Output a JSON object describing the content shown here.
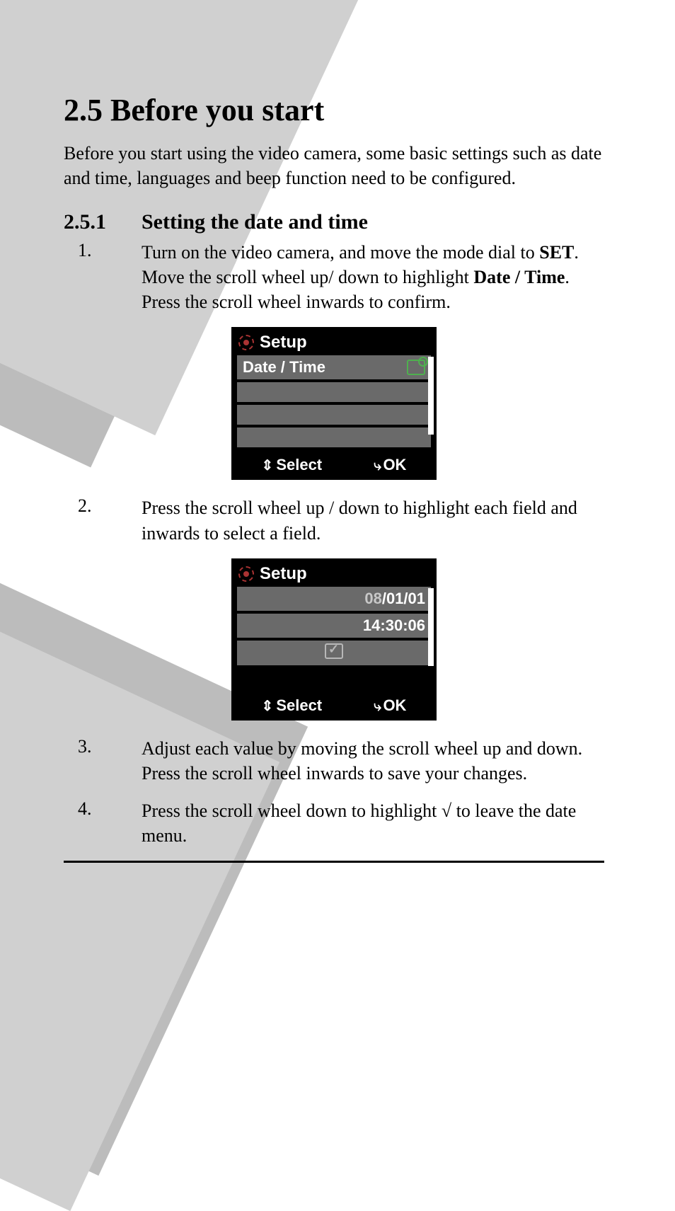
{
  "section": {
    "number": "2.5",
    "title": "Before you start",
    "intro": "Before you start using the video camera, some basic settings such as date and time, languages and beep function need to be configured."
  },
  "subsection": {
    "number": "2.5.1",
    "title": "Setting the date and time"
  },
  "steps": {
    "s1": {
      "num": "1.",
      "pre": "Turn on the video camera, and move the mode dial to ",
      "bold1": "SET",
      "mid": ". Move the scroll wheel up/ down to highlight ",
      "bold2": "Date / Time",
      "post": ". Press the scroll wheel inwards to confirm."
    },
    "s2": {
      "num": "2.",
      "text": "Press the scroll wheel up / down to highlight each field and inwards to select a field."
    },
    "s3": {
      "num": "3.",
      "text": "Adjust each value by moving the scroll wheel up and down. Press the scroll wheel inwards to save your changes."
    },
    "s4": {
      "num": "4.",
      "pre": "Press the scroll wheel down to highlight ",
      "symbol": "√",
      "post": "  to leave the date menu."
    }
  },
  "lcd1": {
    "title": "Setup",
    "highlight": "Date / Time",
    "footer_select": "Select",
    "footer_ok": "OK"
  },
  "lcd2": {
    "title": "Setup",
    "date_grey": "08",
    "date_rest": "/01/01",
    "time": "14:30:06",
    "footer_select": "Select",
    "footer_ok": "OK"
  }
}
